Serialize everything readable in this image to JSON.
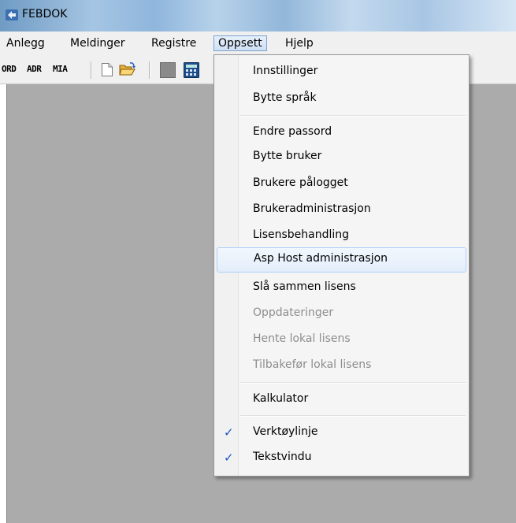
{
  "window": {
    "title": "FEBDOK"
  },
  "menubar": {
    "items": [
      {
        "label": "Anlegg"
      },
      {
        "label": "Meldinger"
      },
      {
        "label": "Registre"
      },
      {
        "label": "Oppsett"
      },
      {
        "label": "Hjelp"
      }
    ]
  },
  "toolbar": {
    "text_buttons": [
      "ORD",
      "ADR",
      "MIA"
    ],
    "icons": [
      "new-document-icon",
      "open-folder-icon",
      "gray-square-icon",
      "calculator-icon"
    ]
  },
  "dropdown": {
    "items": [
      {
        "label": "Innstillinger",
        "enabled": true
      },
      {
        "label": "Bytte språk",
        "enabled": true
      },
      {
        "label": "Endre passord",
        "enabled": true
      },
      {
        "label": "Bytte bruker",
        "enabled": true
      },
      {
        "label": "Brukere pålogget",
        "enabled": true
      },
      {
        "label": "Brukeradministrasjon",
        "enabled": true
      },
      {
        "label": "Lisensbehandling",
        "enabled": true
      },
      {
        "label": "Asp Host administrasjon",
        "enabled": true,
        "highlighted": true
      },
      {
        "label": "Slå sammen lisens",
        "enabled": true
      },
      {
        "label": "Oppdateringer",
        "enabled": false
      },
      {
        "label": "Hente lokal lisens",
        "enabled": false
      },
      {
        "label": "Tilbakefør lokal lisens",
        "enabled": false
      },
      {
        "label": "Kalkulator",
        "enabled": true
      },
      {
        "label": "Verktøylinje",
        "enabled": true,
        "checked": true
      },
      {
        "label": "Tekstvindu",
        "enabled": true,
        "checked": true
      }
    ],
    "check_glyph": "✓"
  },
  "colors": {
    "workspace": "#ababab",
    "menu_bg": "#f0f0f0",
    "highlight_border": "#aecff7",
    "check": "#1a57c0"
  }
}
